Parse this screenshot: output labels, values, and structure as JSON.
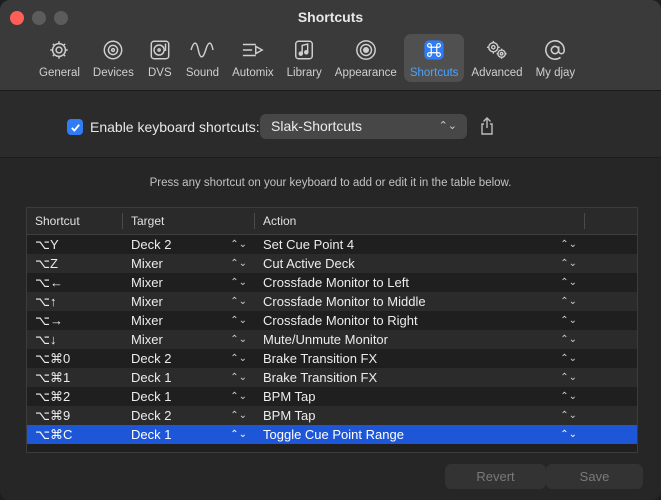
{
  "window": {
    "title": "Shortcuts"
  },
  "toolbar": {
    "items": [
      {
        "label": "General",
        "icon": "gear-icon"
      },
      {
        "label": "Devices",
        "icon": "speaker-icon"
      },
      {
        "label": "DVS",
        "icon": "turntable-icon"
      },
      {
        "label": "Sound",
        "icon": "waveform-icon"
      },
      {
        "label": "Automix",
        "icon": "automix-icon"
      },
      {
        "label": "Library",
        "icon": "music-note-icon"
      },
      {
        "label": "Appearance",
        "icon": "eye-icon"
      },
      {
        "label": "Shortcuts",
        "icon": "command-icon",
        "active": true
      },
      {
        "label": "Advanced",
        "icon": "gears-icon"
      },
      {
        "label": "My djay",
        "icon": "at-icon"
      }
    ],
    "active_color": "#4aa3ff"
  },
  "settings": {
    "enable_label": "Enable keyboard shortcuts:",
    "enabled": true,
    "preset_value": "Slak-Shortcuts"
  },
  "hint": "Press any shortcut on your keyboard to add or edit it in the table below.",
  "table": {
    "headers": {
      "shortcut": "Shortcut",
      "target": "Target",
      "action": "Action"
    },
    "rows": [
      {
        "shortcut": "⌥Y",
        "target": "Deck 2",
        "action": "Set Cue Point 4"
      },
      {
        "shortcut": "⌥Z",
        "target": "Mixer",
        "action": "Cut Active Deck"
      },
      {
        "shortcut": "⌥←",
        "target": "Mixer",
        "action": "Crossfade Monitor to Left"
      },
      {
        "shortcut": "⌥↑",
        "target": "Mixer",
        "action": "Crossfade Monitor to Middle"
      },
      {
        "shortcut": "⌥→",
        "target": "Mixer",
        "action": "Crossfade Monitor to Right"
      },
      {
        "shortcut": "⌥↓",
        "target": "Mixer",
        "action": "Mute/Unmute Monitor"
      },
      {
        "shortcut": "⌥⌘0",
        "target": "Deck 2",
        "action": "Brake Transition FX"
      },
      {
        "shortcut": "⌥⌘1",
        "target": "Deck 1",
        "action": "Brake Transition FX"
      },
      {
        "shortcut": "⌥⌘2",
        "target": "Deck 1",
        "action": "BPM Tap"
      },
      {
        "shortcut": "⌥⌘9",
        "target": "Deck 2",
        "action": "BPM Tap"
      },
      {
        "shortcut": "⌥⌘C",
        "target": "Deck 1",
        "action": "Toggle Cue Point Range",
        "selected": true
      }
    ],
    "selection_color": "#1d56d6"
  },
  "buttons": {
    "revert": "Revert",
    "save": "Save"
  }
}
